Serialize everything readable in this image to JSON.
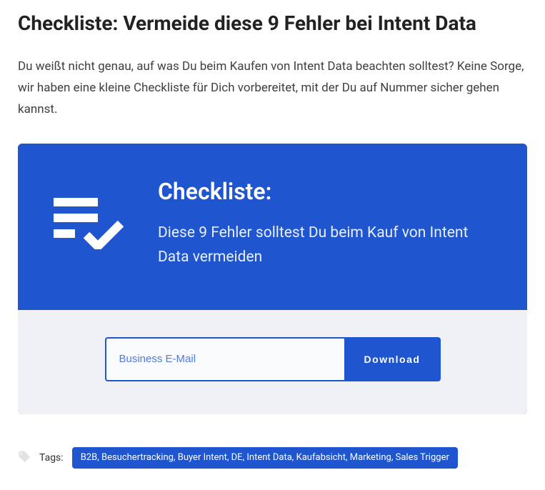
{
  "title": "Checkliste: Vermeide diese 9 Fehler bei Intent Data",
  "intro": "Du weißt nicht genau, auf was Du beim Kaufen von Intent Data beachten solltest? Keine Sorge, wir haben eine kleine Checkliste für Dich vorbereitet, mit der Du auf Nummer sicher gehen kannst.",
  "card": {
    "heading": "Checkliste:",
    "sub": "Diese 9 Fehler solltest Du beim Kauf von Intent Data vermeiden"
  },
  "form": {
    "placeholder": "Business E-Mail",
    "button": "Download"
  },
  "tags": {
    "label": "Tags:",
    "list": "B2B, Besuchertracking, Buyer Intent, DE, Intent Data, Kaufabsicht, Marketing, Sales Trigger"
  },
  "colors": {
    "accent": "#1f55cf"
  }
}
